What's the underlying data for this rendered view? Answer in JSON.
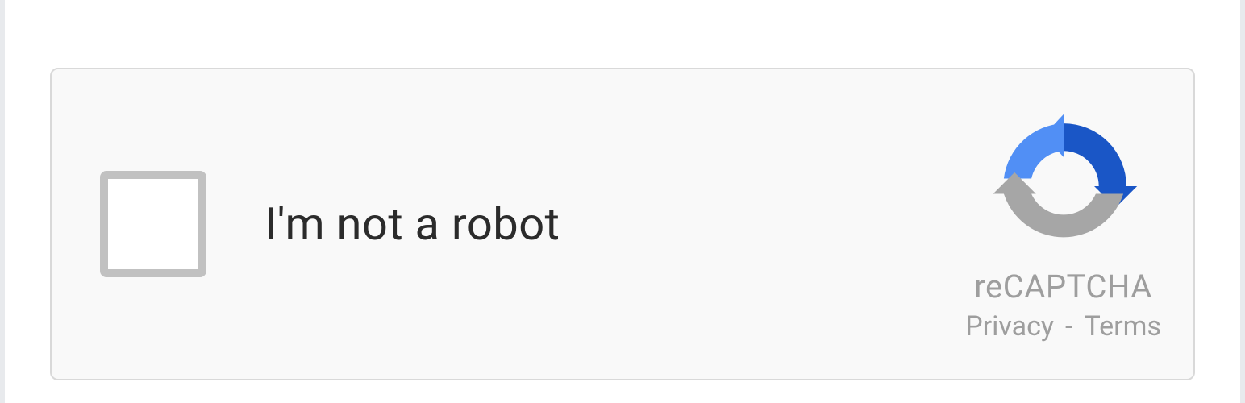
{
  "captcha": {
    "checkbox_label": "I'm not a robot",
    "brand": "reCAPTCHA",
    "privacy_label": "Privacy",
    "terms_label": "Terms",
    "separator": "-"
  },
  "icons": {
    "recaptcha_logo": "recaptcha-logo-icon"
  },
  "colors": {
    "box_bg": "#f9f9f9",
    "box_border": "#d9d9d9",
    "checkbox_border": "#c1c1c1",
    "text_muted": "#9e9e9e",
    "text_main": "#2b2b2b",
    "arrow_light_blue": "#518ff5",
    "arrow_dark_blue": "#1a56c6",
    "arrow_grey": "#a6a6a6"
  }
}
